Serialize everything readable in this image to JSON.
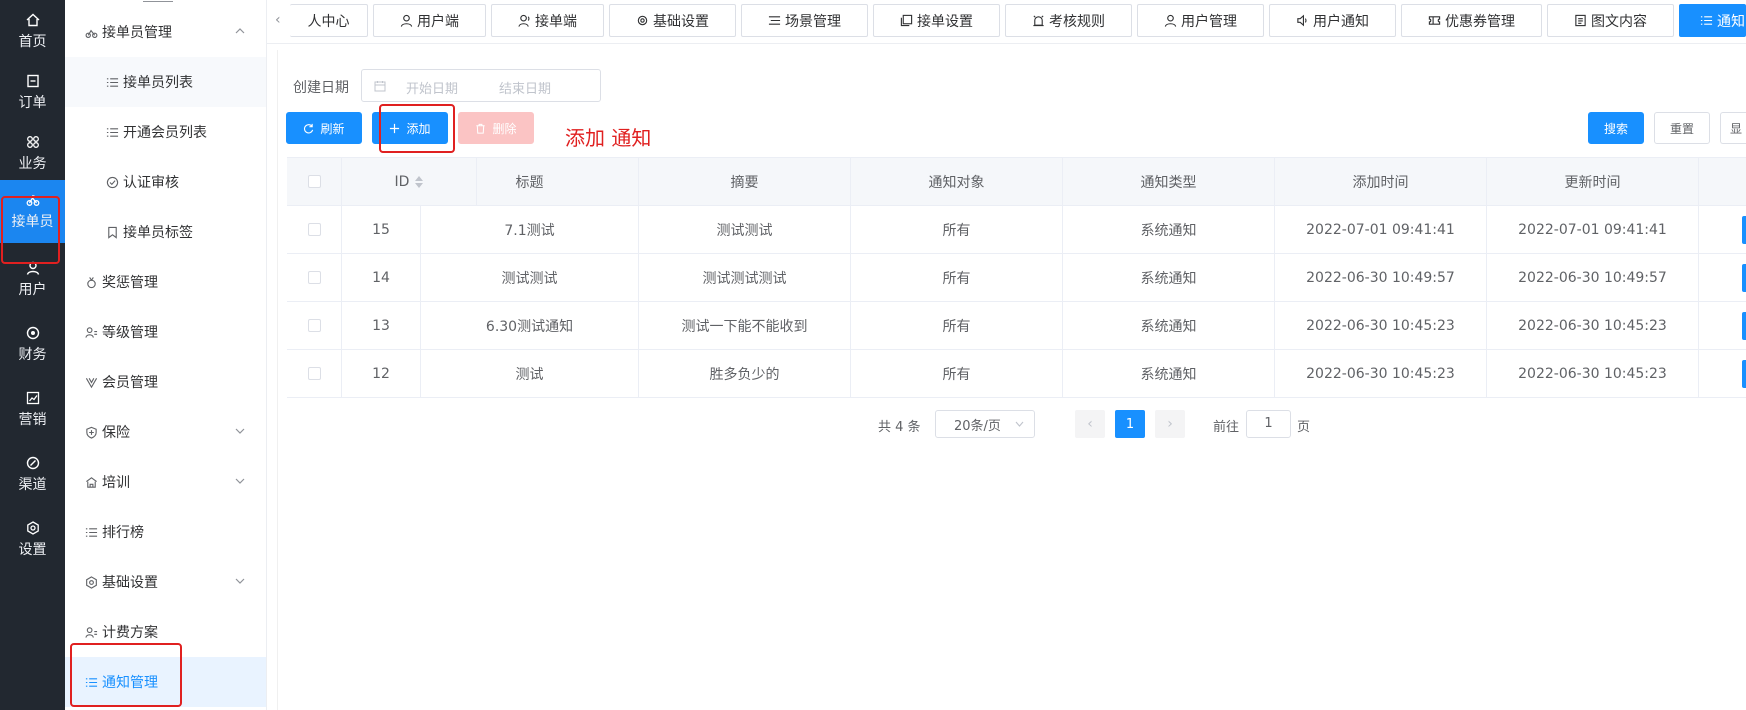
{
  "rail": {
    "items": [
      {
        "label": "首页",
        "icon": "home-icon"
      },
      {
        "label": "订单",
        "icon": "order-icon"
      },
      {
        "label": "业务",
        "icon": "business-icon"
      },
      {
        "label": "接单员",
        "icon": "rider-icon",
        "active": true
      },
      {
        "label": "用户",
        "icon": "user-icon"
      },
      {
        "label": "财务",
        "icon": "finance-icon"
      },
      {
        "label": "营销",
        "icon": "chart-icon"
      },
      {
        "label": "渠道",
        "icon": "channel-icon"
      },
      {
        "label": "设置",
        "icon": "settings-icon"
      }
    ]
  },
  "sidebar": {
    "items": [
      {
        "label": "接单员管理",
        "level": 1,
        "icon": "rider-icon",
        "expanded": true
      },
      {
        "label": "接单员列表",
        "level": 2,
        "icon": "list-icon"
      },
      {
        "label": "开通会员列表",
        "level": 2,
        "icon": "list-icon"
      },
      {
        "label": "认证审核",
        "level": 2,
        "icon": "check-circle-icon"
      },
      {
        "label": "接单员标签",
        "level": 2,
        "icon": "bookmark-icon"
      },
      {
        "label": "奖惩管理",
        "level": 1,
        "icon": "medal-icon"
      },
      {
        "label": "等级管理",
        "level": 1,
        "icon": "users-icon"
      },
      {
        "label": "会员管理",
        "level": 1,
        "icon": "vip-icon"
      },
      {
        "label": "保险",
        "level": 1,
        "icon": "shield-icon",
        "collapsed": true
      },
      {
        "label": "培训",
        "level": 1,
        "icon": "training-icon",
        "collapsed": true
      },
      {
        "label": "排行榜",
        "level": 1,
        "icon": "list-icon"
      },
      {
        "label": "基础设置",
        "level": 1,
        "icon": "settings-icon",
        "collapsed": true
      },
      {
        "label": "计费方案",
        "level": 1,
        "icon": "users-icon"
      },
      {
        "label": "通知管理",
        "level": 1,
        "icon": "list-icon",
        "active": true
      }
    ]
  },
  "tabs": [
    {
      "label": "人中心",
      "icon": ""
    },
    {
      "label": "用户端",
      "icon": "user-icon"
    },
    {
      "label": "接单端",
      "icon": "headset-icon"
    },
    {
      "label": "基础设置",
      "icon": "gear-icon"
    },
    {
      "label": "场景管理",
      "icon": "menu-icon"
    },
    {
      "label": "接单设置",
      "icon": "copy-icon"
    },
    {
      "label": "考核规则",
      "icon": "alarm-icon"
    },
    {
      "label": "用户管理",
      "icon": "user-icon"
    },
    {
      "label": "用户通知",
      "icon": "speaker-icon"
    },
    {
      "label": "优惠券管理",
      "icon": "ticket-icon"
    },
    {
      "label": "图文内容",
      "icon": "document-icon"
    },
    {
      "label": "通知",
      "icon": "list-icon",
      "active": true
    }
  ],
  "filter": {
    "date_label": "创建日期",
    "start_placeholder": "开始日期",
    "end_placeholder": "结束日期"
  },
  "toolbar": {
    "refresh": "刷新",
    "add": "添加",
    "delete": "删除",
    "search": "搜索",
    "reset": "重置",
    "show": "显"
  },
  "annotation": "添加 通知",
  "table": {
    "columns": [
      "ID",
      "标题",
      "摘要",
      "通知对象",
      "通知类型",
      "添加时间",
      "更新时间"
    ],
    "rows": [
      {
        "id": "15",
        "title": "7.1测试",
        "summary": "测试测试",
        "target": "所有",
        "type": "系统通知",
        "created": "2022-07-01 09:41:41",
        "updated": "2022-07-01 09:41:41"
      },
      {
        "id": "14",
        "title": "测试测试",
        "summary": "测试测试测试",
        "target": "所有",
        "type": "系统通知",
        "created": "2022-06-30 10:49:57",
        "updated": "2022-06-30 10:49:57"
      },
      {
        "id": "13",
        "title": "6.30测试通知",
        "summary": "测试一下能不能收到",
        "target": "所有",
        "type": "系统通知",
        "created": "2022-06-30 10:45:23",
        "updated": "2022-06-30 10:45:23"
      },
      {
        "id": "12",
        "title": "测试",
        "summary": "胜多负少的",
        "target": "所有",
        "type": "系统通知",
        "created": "2022-06-30 10:45:23",
        "updated": "2022-06-30 10:45:23"
      }
    ]
  },
  "pagination": {
    "total": "共 4 条",
    "page_size": "20条/页",
    "prev": "‹",
    "current": "1",
    "next": "›",
    "goto_label": "前往",
    "goto_value": "1",
    "page_suffix": "页"
  },
  "colors": {
    "primary": "#1890ff",
    "rail_bg": "#222830",
    "highlight": "#e02020",
    "danger_disabled": "#fbc4c4"
  }
}
